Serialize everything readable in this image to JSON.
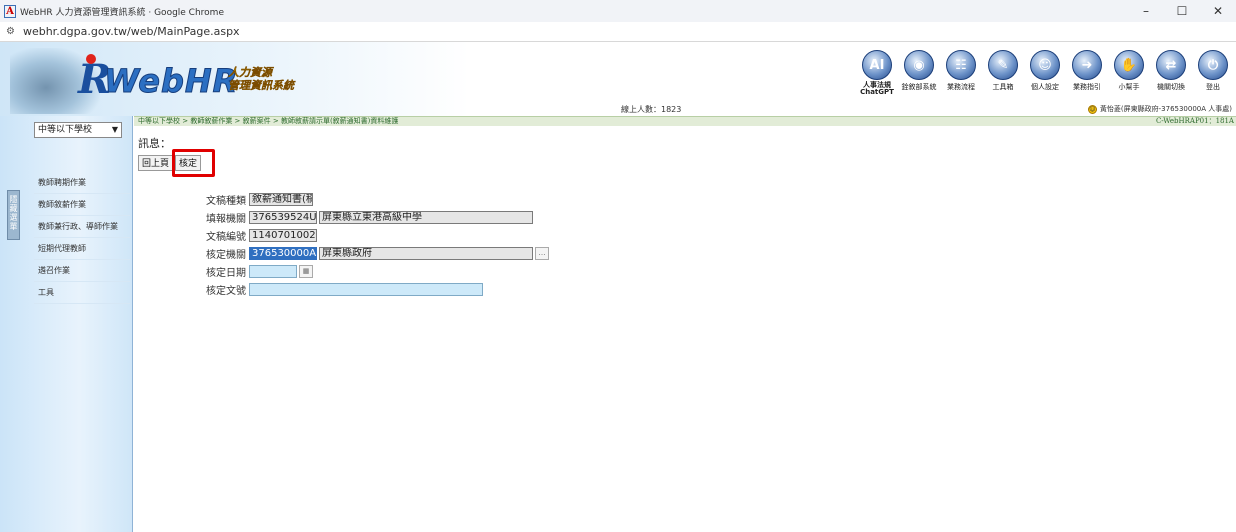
{
  "browser": {
    "window_title": "WebHR 人力資源管理資訊系統 · Google Chrome",
    "url": "webhr.dgpa.gov.tw/web/MainPage.aspx",
    "controls": {
      "minimize": "–",
      "maximize": "☐",
      "close": "✕"
    }
  },
  "header": {
    "logo_main": "WebHR",
    "logo_sub_line1": "人力資源",
    "logo_sub_line2": "管理資訊系統",
    "online_users": "線上人數：1823",
    "toolbar": [
      {
        "icon": "ai",
        "label": "人事法規\nChatGPT"
      },
      {
        "icon": "seal",
        "label": "銓敘部系統"
      },
      {
        "icon": "flow",
        "label": "業務流程"
      },
      {
        "icon": "tools",
        "label": "工具箱"
      },
      {
        "icon": "person",
        "label": "個人設定"
      },
      {
        "icon": "guide",
        "label": "業務指引"
      },
      {
        "icon": "helper",
        "label": "小幫手"
      },
      {
        "icon": "switch",
        "label": "機關切換"
      },
      {
        "icon": "logout",
        "label": "登出"
      }
    ],
    "user_info": "黃怡菱(屏東縣政府-376530000A 人事處)"
  },
  "sidebar": {
    "school_select": "中等以下學校",
    "tab_label": "隱藏選單",
    "items": [
      "教師聘期作業",
      "教師敘薪作業",
      "教師兼行政、導師作業",
      "短期代理教師",
      "遴召作業",
      "工具"
    ]
  },
  "breadcrumb": "中等以下學校 > 教師敘薪作業 > 敘薪案件 > 教師敘薪請示單(敘薪通知書)資料維護",
  "server_id": "C-WebHRAP01：181A",
  "message_label": "訊息：",
  "buttons": {
    "back": "回上頁",
    "approve": "核定"
  },
  "form": [
    {
      "label": "文稿種類",
      "fields": [
        {
          "value": "敘薪通知書(稿",
          "style": "ro",
          "w": 64
        }
      ]
    },
    {
      "label": "填報機關",
      "fields": [
        {
          "value": "376539524U",
          "style": "ro",
          "w": 68
        },
        {
          "value": "屏東縣立東港高級中學",
          "style": "ro",
          "w": 214
        }
      ]
    },
    {
      "label": "文稿編號",
      "fields": [
        {
          "value": "1140701002",
          "style": "ro",
          "w": 68
        }
      ]
    },
    {
      "label": "核定機關",
      "fields": [
        {
          "value": "376530000A",
          "style": "sel",
          "w": 68
        },
        {
          "value": "屏東縣政府",
          "style": "ro",
          "w": 214
        }
      ],
      "picker": true
    },
    {
      "label": "核定日期",
      "fields": [
        {
          "value": "",
          "style": "blue",
          "w": 48
        }
      ],
      "picker": true
    },
    {
      "label": "核定文號",
      "fields": [
        {
          "value": "",
          "style": "blue",
          "w": 234
        }
      ]
    }
  ]
}
